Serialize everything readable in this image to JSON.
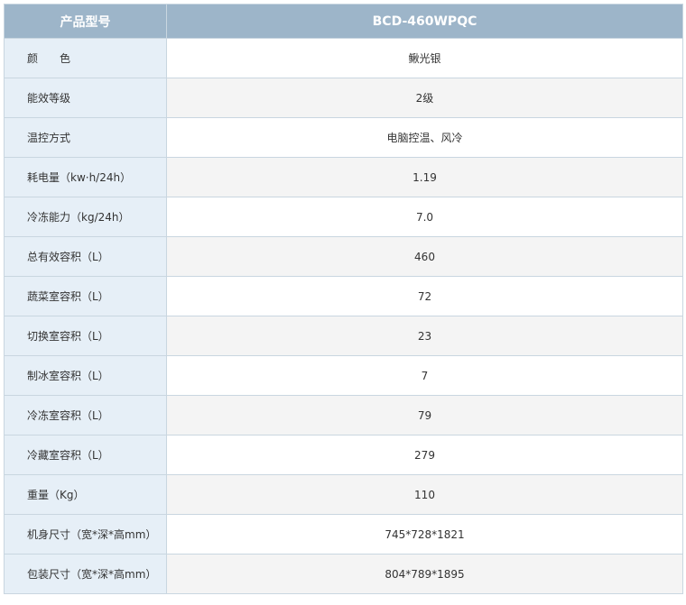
{
  "header": {
    "label": "产品型号",
    "model": "BCD-460WPQC"
  },
  "rows": [
    {
      "label": "颜　　色",
      "value": "鳅光银"
    },
    {
      "label": "能效等级",
      "value": "2级"
    },
    {
      "label": "温控方式",
      "value": "电脑控温、风冷"
    },
    {
      "label": "耗电量（kw·h/24h）",
      "value": "1.19"
    },
    {
      "label": "冷冻能力（kg/24h）",
      "value": "7.0"
    },
    {
      "label": "总有效容积（L）",
      "value": "460"
    },
    {
      "label": "蔬菜室容积（L）",
      "value": "72"
    },
    {
      "label": "切换室容积（L）",
      "value": "23"
    },
    {
      "label": "制冰室容积（L）",
      "value": "7"
    },
    {
      "label": "冷冻室容积（L）",
      "value": "79"
    },
    {
      "label": "冷藏室容积（L）",
      "value": "279"
    },
    {
      "label": "重量（Kg）",
      "value": "110"
    },
    {
      "label": "机身尺寸（宽*深*高mm）",
      "value": "745*728*1821"
    },
    {
      "label": "包装尺寸（宽*深*高mm）",
      "value": "804*789*1895"
    }
  ]
}
